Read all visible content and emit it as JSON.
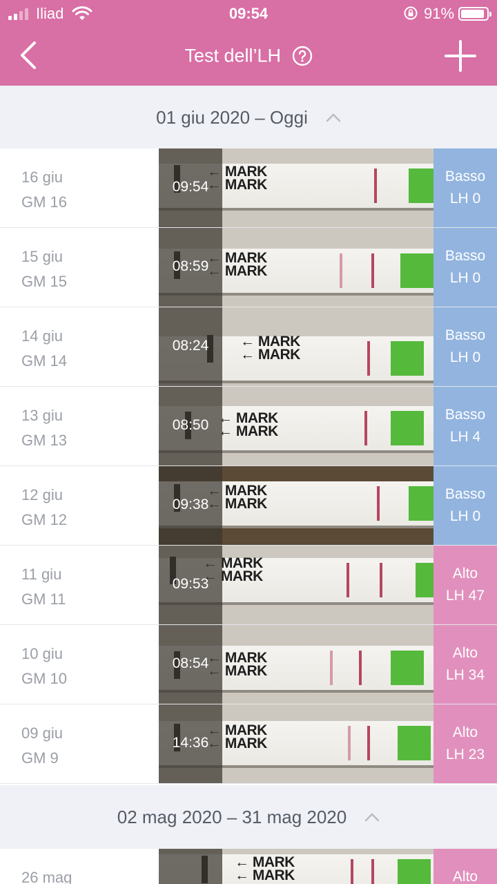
{
  "status_bar": {
    "carrier": "Iliad",
    "time": "09:54",
    "battery": "91%",
    "battery_level": 0.91
  },
  "nav": {
    "title": "Test dell’LH"
  },
  "sections": [
    {
      "label": "01 giu 2020 – Oggi"
    },
    {
      "label": "02 mag 2020 – 31 mag 2020"
    }
  ],
  "rows": [
    {
      "date": "16 giu",
      "cycle_day": "GM 16",
      "time": "09:54",
      "result": "Basso",
      "lh": "LH 0",
      "level": "low"
    },
    {
      "date": "15 giu",
      "cycle_day": "GM 15",
      "time": "08:59",
      "result": "Basso",
      "lh": "LH 0",
      "level": "low"
    },
    {
      "date": "14 giu",
      "cycle_day": "GM 14",
      "time": "08:24",
      "result": "Basso",
      "lh": "LH 0",
      "level": "low"
    },
    {
      "date": "13 giu",
      "cycle_day": "GM 13",
      "time": "08:50",
      "result": "Basso",
      "lh": "LH 4",
      "level": "low"
    },
    {
      "date": "12 giu",
      "cycle_day": "GM 12",
      "time": "09:38",
      "result": "Basso",
      "lh": "LH 0",
      "level": "low"
    },
    {
      "date": "11 giu",
      "cycle_day": "GM 11",
      "time": "09:53",
      "result": "Alto",
      "lh": "LH 47",
      "level": "high"
    },
    {
      "date": "10 giu",
      "cycle_day": "GM 10",
      "time": "08:54",
      "result": "Alto",
      "lh": "LH 34",
      "level": "high"
    },
    {
      "date": "09 giu",
      "cycle_day": "GM 9",
      "time": "14:36",
      "result": "Alto",
      "lh": "LH 23",
      "level": "high"
    },
    {
      "date": "26 mag",
      "cycle_day": "",
      "time": "",
      "result": "Alto",
      "lh": "",
      "level": "high"
    }
  ],
  "test_strip": {
    "mark_label": "MARK"
  },
  "colors": {
    "accent": "#d86fa5",
    "low": "#92b4df",
    "high": "#e190bd",
    "section_bg": "#eff1f6"
  },
  "icons": {
    "back": "chevron-left-icon",
    "help": "question-circle-icon",
    "add": "plus-icon",
    "collapse": "chevron-up-icon"
  }
}
